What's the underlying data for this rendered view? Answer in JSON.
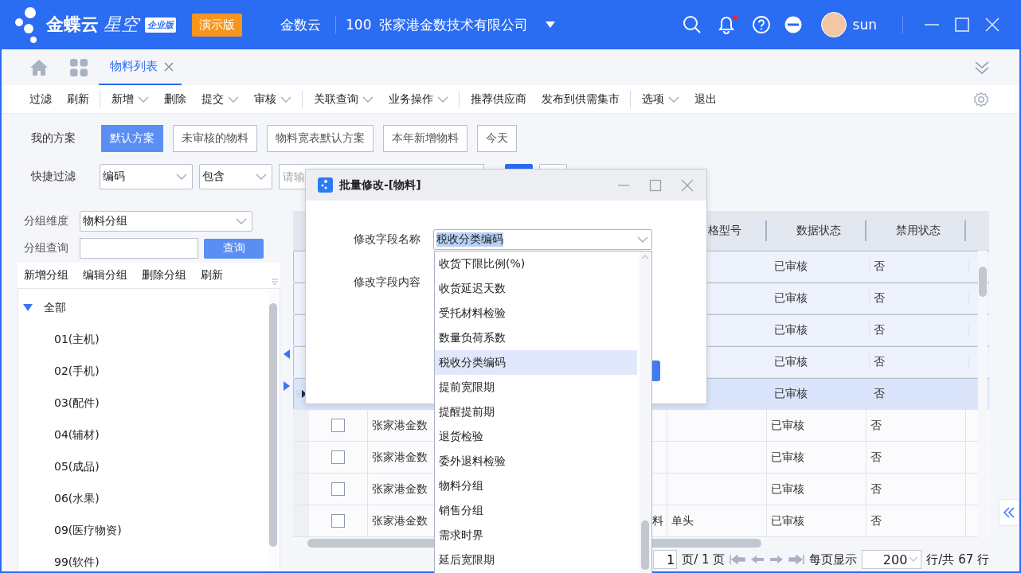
{
  "header": {
    "brand": "金蝶云",
    "product": "星空",
    "edition": "企业版",
    "demo_badge": "演示版",
    "tenant": "金数云",
    "org_code": "100",
    "org_name": "张家港金数技术有限公司",
    "notification_unread": true,
    "user": "sun"
  },
  "tabs": [
    {
      "label": "物料列表",
      "selected": true
    }
  ],
  "toolbar": [
    {
      "label": "过滤",
      "menu": false,
      "divider_before": false
    },
    {
      "label": "刷新",
      "menu": false,
      "divider_before": false
    },
    {
      "label": "新增",
      "menu": true,
      "divider_before": true
    },
    {
      "label": "删除",
      "menu": false,
      "divider_before": false
    },
    {
      "label": "提交",
      "menu": true,
      "divider_before": false
    },
    {
      "label": "审核",
      "menu": true,
      "divider_before": false
    },
    {
      "label": "关联查询",
      "menu": true,
      "divider_before": true
    },
    {
      "label": "业务操作",
      "menu": true,
      "divider_before": false
    },
    {
      "label": "推荐供应商",
      "menu": false,
      "divider_before": true
    },
    {
      "label": "发布到供需集市",
      "menu": false,
      "divider_before": false
    },
    {
      "label": "选项",
      "menu": true,
      "divider_before": true
    },
    {
      "label": "退出",
      "menu": false,
      "divider_before": false
    }
  ],
  "schemes": {
    "label": "我的方案",
    "items": [
      {
        "label": "默认方案",
        "selected": true
      },
      {
        "label": "未审核的物料",
        "selected": false
      },
      {
        "label": "物料宽表默认方案",
        "selected": false
      },
      {
        "label": "本年新增物料",
        "selected": false
      },
      {
        "label": "今天",
        "selected": false
      }
    ]
  },
  "quick_filter": {
    "label": "快捷过滤",
    "field": "编码",
    "operator": "包含",
    "placeholder": "请输"
  },
  "group_panel": {
    "dimension_label": "分组维度",
    "dimension": "物料分组",
    "search_label": "分组查询",
    "search_button": "查询",
    "actions": [
      "新增分组",
      "编辑分组",
      "删除分组",
      "刷新"
    ],
    "tree": [
      {
        "label": "全部",
        "expanded": true,
        "children": [
          {
            "label": "01(主机)"
          },
          {
            "label": "02(手机)"
          },
          {
            "label": "03(配件)"
          },
          {
            "label": "04(辅材)"
          },
          {
            "label": "05(成品)"
          },
          {
            "label": "06(水果)"
          },
          {
            "label": "09(医疗物资)"
          },
          {
            "label": "99(软件)"
          }
        ]
      }
    ]
  },
  "table": {
    "columns": [
      "格型号",
      "数据状态",
      "禁用状态"
    ],
    "rows": [
      {
        "selected": true,
        "current": false,
        "status": "已审核",
        "disabled": "否"
      },
      {
        "selected": true,
        "current": false,
        "status": "已审核",
        "disabled": "否"
      },
      {
        "selected": true,
        "current": false,
        "status": "已审核",
        "disabled": "否"
      },
      {
        "selected": true,
        "current": false,
        "status": "已审核",
        "disabled": "否"
      },
      {
        "selected": true,
        "current": true,
        "status": "已审核",
        "disabled": "否"
      },
      {
        "selected": false,
        "current": false,
        "checked": false,
        "column_2": "张家港金数",
        "status": "已审核",
        "disabled": "否"
      },
      {
        "selected": false,
        "current": false,
        "checked": false,
        "column_2": "张家港金数",
        "status": "已审核",
        "disabled": "否"
      },
      {
        "selected": false,
        "current": false,
        "checked": false,
        "column_2": "张家港金数",
        "status": "已审核",
        "disabled": "否"
      },
      {
        "selected": false,
        "current": false,
        "checked": false,
        "column_2": "张家港金数",
        "column_3": "料",
        "specification": "单头",
        "status": "已审核",
        "disabled": "否"
      }
    ],
    "pagination": {
      "page": "1",
      "pages": "页/ 1 页",
      "per_page_label": "每页显示",
      "per_page": "200",
      "total": "行/共 67 行"
    }
  },
  "dialog": {
    "title": "批量修改-[物料]",
    "field_name_label": "修改字段名称",
    "field_name": "税收分类编码",
    "field_content_label": "修改字段内容",
    "options": [
      {
        "label": "收货下限比例(%)",
        "selected": false
      },
      {
        "label": "收货延迟天数",
        "selected": false
      },
      {
        "label": "受托材料检验",
        "selected": false
      },
      {
        "label": "数量负荷系数",
        "selected": false
      },
      {
        "label": "税收分类编码",
        "selected": true
      },
      {
        "label": "提前宽限期",
        "selected": false
      },
      {
        "label": "提醒提前期",
        "selected": false
      },
      {
        "label": "退货检验",
        "selected": false
      },
      {
        "label": "委外退料检验",
        "selected": false
      },
      {
        "label": "物料分组",
        "selected": false
      },
      {
        "label": "销售分组",
        "selected": false
      },
      {
        "label": "需求时界",
        "selected": false
      },
      {
        "label": "延后宽限期",
        "selected": false
      }
    ]
  }
}
